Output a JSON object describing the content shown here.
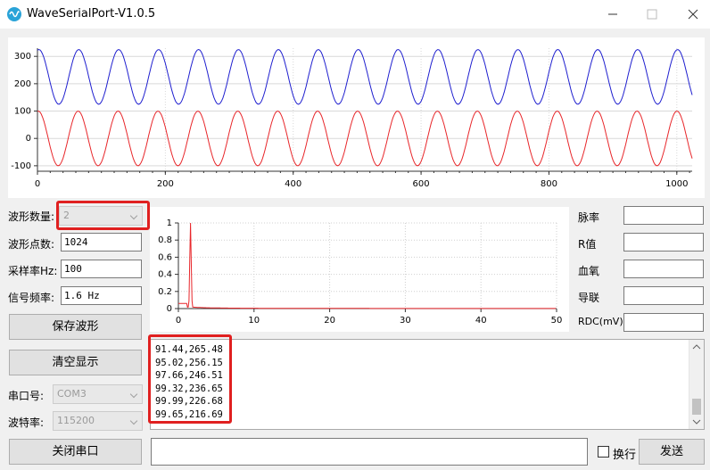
{
  "window": {
    "title": "WaveSerialPort-V1.0.5",
    "min_icon": "minimize-icon",
    "max_icon": "maximize-icon",
    "close_icon": "close-icon"
  },
  "wave_plot": {
    "x_ticks": [
      "0",
      "200",
      "400",
      "600",
      "800",
      "1000"
    ],
    "y_ticks": [
      "300",
      "200",
      "100",
      "0",
      "-100"
    ],
    "colors": {
      "blue": "#1f1fcf",
      "red": "#e8262a"
    }
  },
  "left_panel": {
    "wave_count_label": "波形数量:",
    "wave_count_value": "2",
    "points_label": "波形点数:",
    "points_value": "1024",
    "sample_rate_label": "采样率Hz:",
    "sample_rate_value": "100",
    "signal_freq_label": "信号频率:",
    "signal_freq_value": "1.6 Hz",
    "save_button": "保存波形",
    "clear_button": "清空显示",
    "port_label": "串口号:",
    "port_value": "COM3",
    "baud_label": "波特率:",
    "baud_value": "115200",
    "close_port_button": "关闭串口"
  },
  "spectrum_plot": {
    "x_ticks": [
      "0",
      "10",
      "20",
      "30",
      "40",
      "50"
    ],
    "y_ticks": [
      "1",
      "0.8",
      "0.6",
      "0.4",
      "0.2",
      "0"
    ]
  },
  "right_panel": {
    "pulse_label": "脉率",
    "r_label": "R值",
    "spo2_label": "血氧",
    "lead_label": "导联",
    "rdc_label": "RDC(mV):"
  },
  "receive_lines": [
    "91.44,265.48",
    "95.02,256.15",
    "97.66,246.51",
    "99.32,236.65",
    "99.99,226.68",
    "99.65,216.69"
  ],
  "bottom": {
    "send_input_value": "",
    "newline_label": "换行",
    "send_button": "发送"
  },
  "chart_data": [
    {
      "type": "line",
      "series": [
        {
          "color": "#1f1fcf",
          "description_values": {
            "center": 225,
            "amplitude": 100,
            "cycles_over_1024": 16.4
          }
        },
        {
          "color": "#e8262a",
          "description_values": {
            "center": 0,
            "amplitude": 100,
            "cycles_over_1024": 16.4
          }
        }
      ],
      "xlim": [
        0,
        1024
      ],
      "ylim": [
        -120,
        330
      ],
      "grid": true
    },
    {
      "type": "line",
      "x_peak": 1.6,
      "y_peak": 1.0,
      "xlim": [
        0,
        50
      ],
      "ylim": [
        0,
        1
      ],
      "grid": true
    }
  ]
}
